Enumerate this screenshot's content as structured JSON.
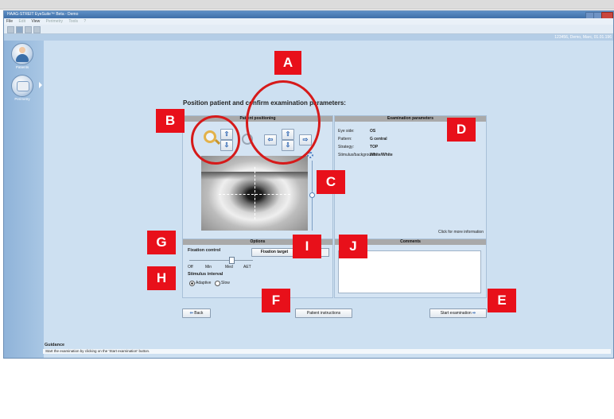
{
  "app": {
    "title": "HAAG-STREIT EyeSuite™ Beta - Demo",
    "menu": [
      "File",
      "Edit",
      "View",
      "Perimetry",
      "Tools",
      "?"
    ],
    "patient_info": "123456, Demo, Marc, 01.01.196"
  },
  "sidebar": {
    "items": [
      {
        "label": "Patients",
        "icon": "patient-icon"
      },
      {
        "label": "Perimetry",
        "icon": "perimetry-icon"
      }
    ]
  },
  "page_title": "Position patient and confirm examination parameters:",
  "positioning": {
    "header": "Patient positioning"
  },
  "exam": {
    "header": "Examination parameters",
    "rows": [
      {
        "key": "Eye side:",
        "value": "OS"
      },
      {
        "key": "Pattern:",
        "value": "G central"
      },
      {
        "key": "Strategy:",
        "value": "TOP"
      },
      {
        "key": "Stimulus/background:",
        "value": "White/White"
      }
    ],
    "more_info": "Click for more information"
  },
  "options": {
    "header": "Options",
    "fixation_label": "Fixation control",
    "slider_ticks": [
      "Off",
      "Min",
      "Med",
      "AET"
    ],
    "stimulus_label": "Stimulus interval",
    "radio_adaptive": "Adaptive",
    "radio_slow": "Slow",
    "fixation_target": "Fixation target"
  },
  "comments": {
    "header": "Comments"
  },
  "buttons": {
    "back": "Back",
    "patient_instructions": "Patient instructions",
    "start": "Start examination"
  },
  "guidance": {
    "title": "Guidance",
    "text": "Start the examination by clicking on the 'Start examination' button."
  },
  "annotations": [
    "A",
    "B",
    "C",
    "D",
    "E",
    "F",
    "G",
    "H",
    "I",
    "J"
  ],
  "colors": {
    "annotation_red": "#e8101a",
    "window_bg": "#cde0f1",
    "panel_header": "#a9a9a9"
  }
}
